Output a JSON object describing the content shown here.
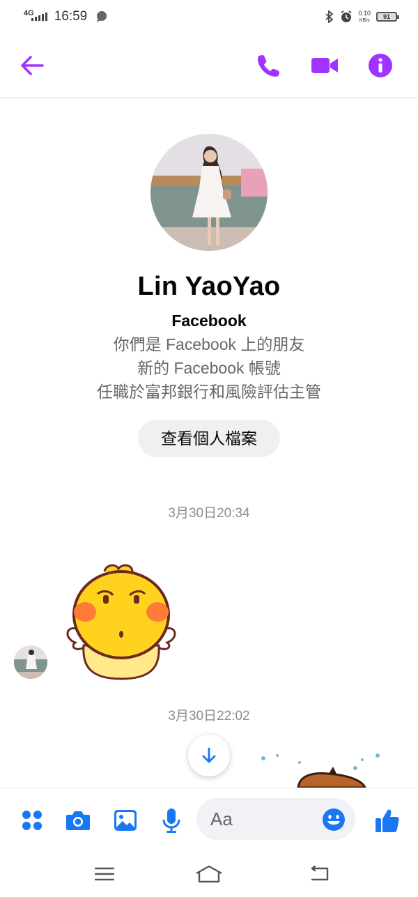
{
  "status_bar": {
    "network": "4G",
    "time": "16:59",
    "net_speed_value": "0.10",
    "net_speed_unit": "KB/s",
    "battery": "91"
  },
  "header": {
    "icons": [
      "back-arrow-icon",
      "phone-icon",
      "video-camera-icon",
      "info-icon"
    ],
    "accent_color": "#a033ff"
  },
  "profile": {
    "name": "Lin YaoYao",
    "platform": "Facebook",
    "friends_text": "你們是 Facebook 上的朋友",
    "new_account_text": "新的 Facebook 帳號",
    "work_text": "任職於富邦銀行和風險評估主管",
    "view_profile_label": "查看個人檔案"
  },
  "messages": {
    "timestamp_1": "3月30日20:34",
    "timestamp_2": "3月30日22:02"
  },
  "composer": {
    "placeholder": "Aa",
    "icons": [
      "apps-grid-icon",
      "camera-icon",
      "gallery-icon",
      "microphone-icon",
      "emoji-icon",
      "thumbs-up-icon"
    ],
    "icon_color": "#1877f2"
  },
  "navbar": {
    "icons": [
      "menu-icon",
      "home-icon",
      "back-icon"
    ]
  }
}
